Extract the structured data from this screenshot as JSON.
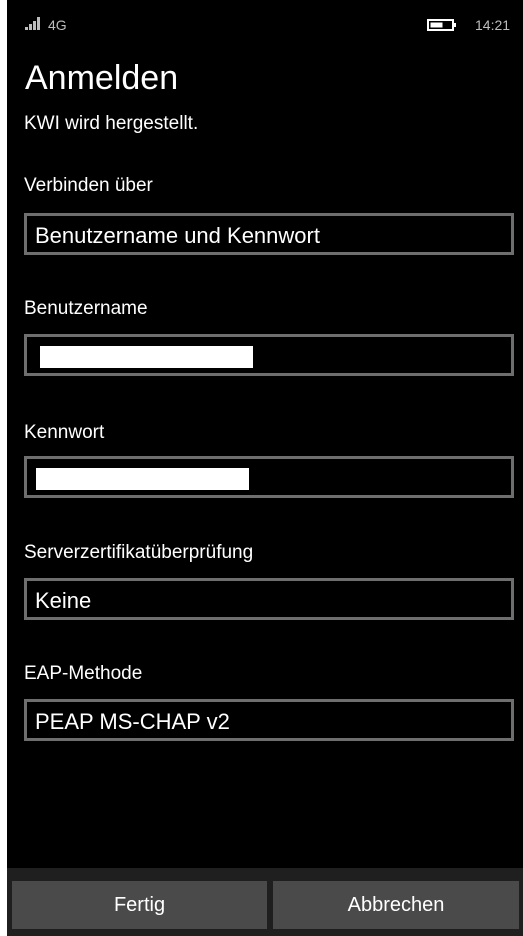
{
  "status_bar": {
    "network": "4G",
    "time": "14:21",
    "signal_icon": "signal-strength-icon",
    "battery_icon": "battery-icon"
  },
  "title": "Anmelden",
  "status_message": "KWI wird hergestellt.",
  "fields": {
    "connect_via": {
      "label": "Verbinden über",
      "value": "Benutzername und Kennwort"
    },
    "username": {
      "label": "Benutzername",
      "value": ""
    },
    "password": {
      "label": "Kennwort",
      "value": ""
    },
    "server_certificate": {
      "label": "Serverzertifikatüberprüfung",
      "value": "Keine"
    },
    "eap_method": {
      "label": "EAP-Methode",
      "value": "PEAP MS-CHAP v2"
    }
  },
  "app_bar": {
    "done_label": "Fertig",
    "cancel_label": "Abbrechen"
  }
}
